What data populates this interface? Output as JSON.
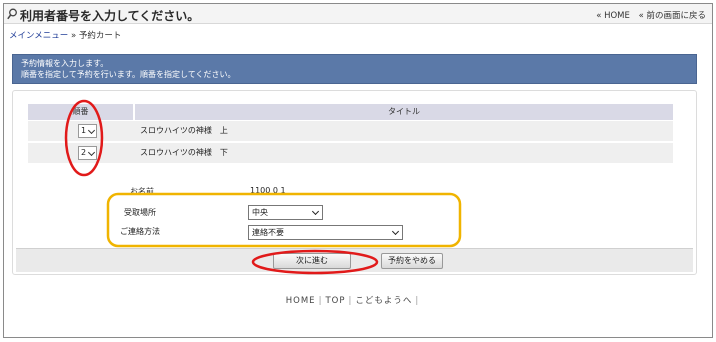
{
  "header": {
    "title": "利用者番号を入力してください。",
    "home_link": "« HOME",
    "back_link": "« 前の画面に戻る"
  },
  "breadcrumb": {
    "main_menu": "メインメニュー",
    "separator": "»",
    "current": "予約カート"
  },
  "info": {
    "line1": "予約情報を入力します。",
    "line2": "順番を指定して予約を行います。順番を指定してください。"
  },
  "table": {
    "headers": {
      "order": "順番",
      "title": "タイトル"
    },
    "rows": [
      {
        "order": "1",
        "title": "スロウハイツの神様　上"
      },
      {
        "order": "2",
        "title": "スロウハイツの神様　下"
      }
    ]
  },
  "form": {
    "name_label": "お名前",
    "name_value": "1100 0 1",
    "pickup_label": "受取場所",
    "pickup_value": "中央",
    "contact_label": "ご連絡方法",
    "contact_value": "連絡不要"
  },
  "buttons": {
    "next": "次に進む",
    "cancel": "予約をやめる"
  },
  "footer": {
    "home": "HOME",
    "top": "TOP",
    "kids": "こどもようへ",
    "sep": "|"
  },
  "colors": {
    "info_bar": "#5b79a8",
    "annotation_red": "#e11a1a",
    "annotation_yellow": "#f0b400"
  }
}
